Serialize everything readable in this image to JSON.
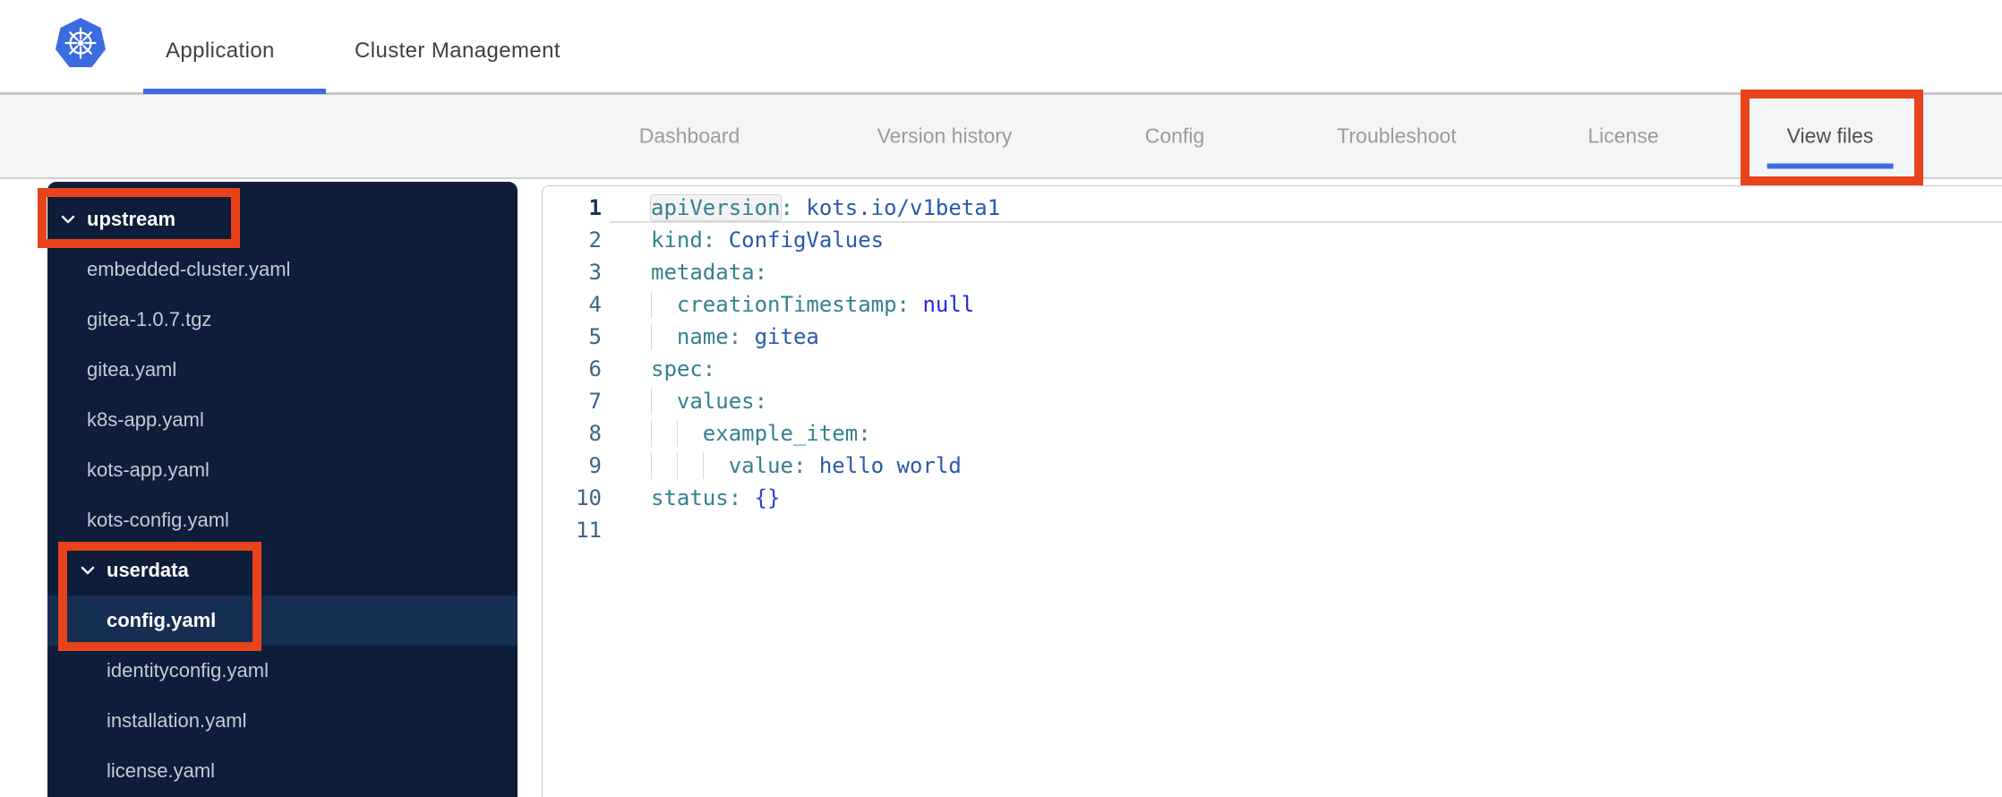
{
  "theme": {
    "annotation_red": "#e8431c",
    "accent_blue": "#3c6ce0",
    "kubernetes_blue": "#3d6ce0",
    "sidebar_bg": "#0e1d39",
    "sidebar_selected_bg": "#162e52",
    "sidebar_file_text": "#c3cbd5",
    "subnav_bg": "#f4f5f7",
    "subnav_text": "#9b9b9b",
    "subnav_active_text": "#4f4f4f",
    "header_text": "#3f3f3f",
    "code_key": "#35818f",
    "code_value": "#2a58ac",
    "code_null": "#2525e6",
    "code_brace": "#2b3fd6",
    "gutter_num": "#3e6488",
    "gutter_num_active": "#1e3159"
  },
  "header": {
    "logo": "kubernetes-logo",
    "tabs": [
      {
        "label": "Application",
        "active": true
      },
      {
        "label": "Cluster Management",
        "active": false
      }
    ]
  },
  "subnav": {
    "items": [
      {
        "label": "Dashboard",
        "active": false
      },
      {
        "label": "Version history",
        "active": false
      },
      {
        "label": "Config",
        "active": false
      },
      {
        "label": "Troubleshoot",
        "active": false
      },
      {
        "label": "License",
        "active": false
      },
      {
        "label": "View files",
        "active": true,
        "annotated": true
      }
    ]
  },
  "file_tree": {
    "items": [
      {
        "label": "upstream",
        "type": "folder",
        "level": 0,
        "expanded": true,
        "annotated": true
      },
      {
        "label": "embedded-cluster.yaml",
        "type": "file",
        "level": 1
      },
      {
        "label": "gitea-1.0.7.tgz",
        "type": "file",
        "level": 1
      },
      {
        "label": "gitea.yaml",
        "type": "file",
        "level": 1
      },
      {
        "label": "k8s-app.yaml",
        "type": "file",
        "level": 1
      },
      {
        "label": "kots-app.yaml",
        "type": "file",
        "level": 1
      },
      {
        "label": "kots-config.yaml",
        "type": "file",
        "level": 1
      },
      {
        "label": "userdata",
        "type": "folder",
        "level": 1,
        "expanded": true,
        "annotated": true
      },
      {
        "label": "config.yaml",
        "type": "file",
        "level": 2,
        "selected": true,
        "annotated": true
      },
      {
        "label": "identityconfig.yaml",
        "type": "file",
        "level": 2
      },
      {
        "label": "installation.yaml",
        "type": "file",
        "level": 2
      },
      {
        "label": "license.yaml",
        "type": "file",
        "level": 2
      }
    ]
  },
  "editor": {
    "language": "yaml",
    "active_line": 1,
    "lines": [
      {
        "num": 1,
        "indent": 0,
        "key": "apiVersion",
        "value": "kots.io/v1beta1",
        "value_type": "string",
        "word_highlight": true
      },
      {
        "num": 2,
        "indent": 0,
        "key": "kind",
        "value": "ConfigValues",
        "value_type": "string"
      },
      {
        "num": 3,
        "indent": 0,
        "key": "metadata",
        "value": "",
        "value_type": "none"
      },
      {
        "num": 4,
        "indent": 2,
        "key": "creationTimestamp",
        "value": "null",
        "value_type": "null"
      },
      {
        "num": 5,
        "indent": 2,
        "key": "name",
        "value": "gitea",
        "value_type": "string"
      },
      {
        "num": 6,
        "indent": 0,
        "key": "spec",
        "value": "",
        "value_type": "none"
      },
      {
        "num": 7,
        "indent": 2,
        "key": "values",
        "value": "",
        "value_type": "none"
      },
      {
        "num": 8,
        "indent": 4,
        "key": "example_item",
        "value": "",
        "value_type": "none"
      },
      {
        "num": 9,
        "indent": 6,
        "key": "value",
        "value": "hello world",
        "value_type": "string"
      },
      {
        "num": 10,
        "indent": 0,
        "key": "status",
        "value": "{}",
        "value_type": "brace"
      },
      {
        "num": 11,
        "indent": 0,
        "key": "",
        "value": "",
        "value_type": "empty"
      }
    ]
  }
}
